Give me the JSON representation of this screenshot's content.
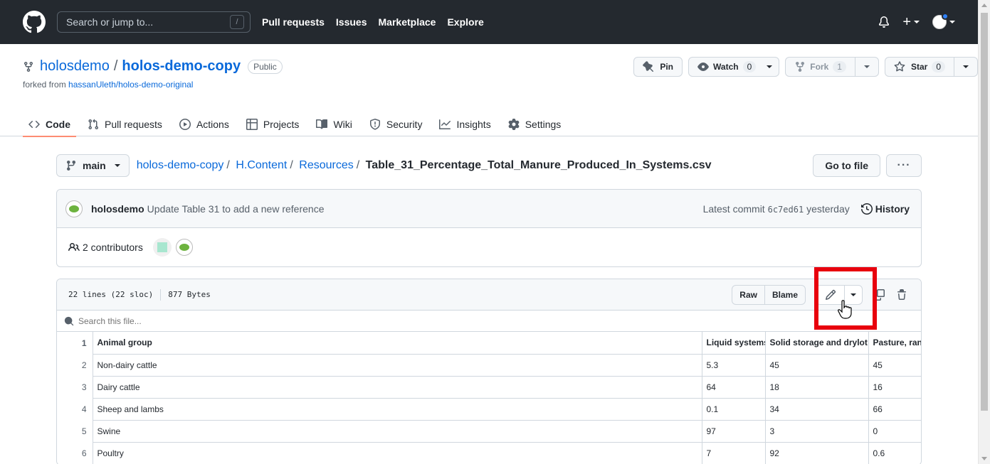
{
  "header": {
    "search_placeholder": "Search or jump to...",
    "search_shortcut": "/",
    "nav": [
      "Pull requests",
      "Issues",
      "Marketplace",
      "Explore"
    ]
  },
  "repo": {
    "owner": "holosdemo",
    "separator": "/",
    "name": "holos-demo-copy",
    "visibility": "Public",
    "forked_prefix": "forked from",
    "forked_from": "hassanUleth/holos-demo-original",
    "pin_label": "Pin",
    "watch_label": "Watch",
    "watch_count": "0",
    "fork_label": "Fork",
    "fork_count": "1",
    "star_label": "Star",
    "star_count": "0"
  },
  "tabs": {
    "code": "Code",
    "pulls": "Pull requests",
    "actions": "Actions",
    "projects": "Projects",
    "wiki": "Wiki",
    "security": "Security",
    "insights": "Insights",
    "settings": "Settings"
  },
  "path": {
    "branch": "main",
    "root": "holos-demo-copy",
    "dir1": "H.Content",
    "dir2": "Resources",
    "file": "Table_31_Percentage_Total_Manure_Produced_In_Systems.csv",
    "goto_file": "Go to file",
    "more": "···"
  },
  "commit": {
    "user": "holosdemo",
    "message": "Update Table 31 to add a new reference",
    "latest_prefix": "Latest commit",
    "sha": "6c7ed61",
    "when": "yesterday",
    "history": "History",
    "contributors": "2 contributors"
  },
  "file": {
    "lines": "22 lines (22 sloc)",
    "size": "877 Bytes",
    "raw": "Raw",
    "blame": "Blame",
    "search_placeholder": "Search this file...",
    "columns": [
      "Animal group",
      "Liquid systems",
      "Solid storage and drylot",
      "Pasture, rang"
    ],
    "rows": [
      {
        "n": "2",
        "cells": [
          "Non-dairy cattle",
          "5.3",
          "45",
          "45"
        ]
      },
      {
        "n": "3",
        "cells": [
          "Dairy cattle",
          "64",
          "18",
          "16"
        ]
      },
      {
        "n": "4",
        "cells": [
          "Sheep and lambs",
          "0.1",
          "34",
          "66"
        ]
      },
      {
        "n": "5",
        "cells": [
          "Swine",
          "97",
          "3",
          "0"
        ]
      },
      {
        "n": "6",
        "cells": [
          "Poultry",
          "7",
          "92",
          "0.6"
        ]
      }
    ],
    "header_line": "1"
  },
  "colors": {
    "header_bg": "#24292f",
    "link": "#0969da",
    "highlight": "#e8000d",
    "tab_underline": "#fd8c73"
  }
}
